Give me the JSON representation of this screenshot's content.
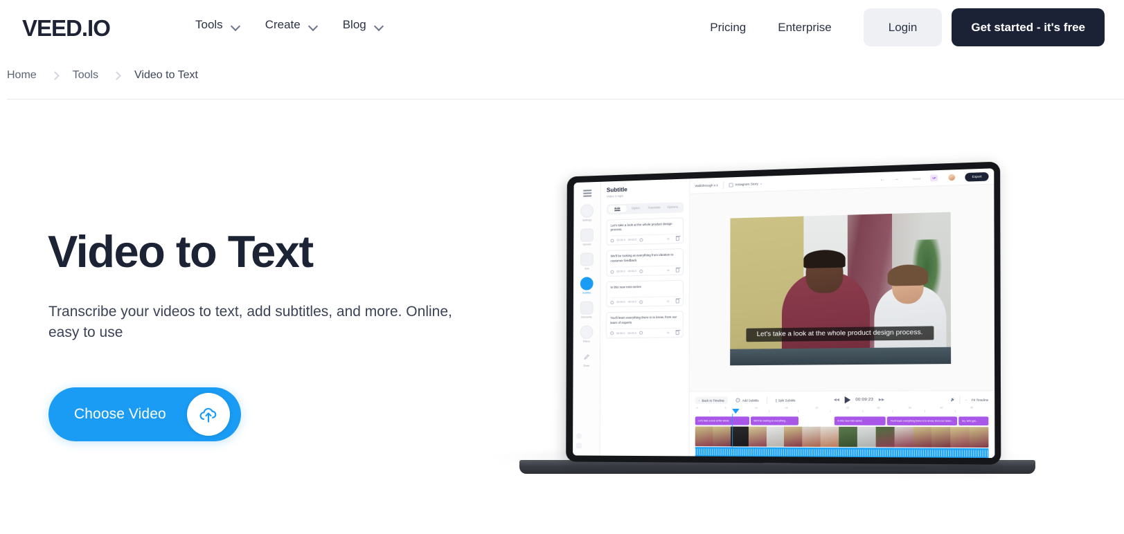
{
  "header": {
    "logo": "VEED.IO",
    "nav": [
      {
        "label": "Tools",
        "has_dropdown": true
      },
      {
        "label": "Create",
        "has_dropdown": true
      },
      {
        "label": "Blog",
        "has_dropdown": true
      }
    ],
    "links": [
      {
        "label": "Pricing"
      },
      {
        "label": "Enterprise"
      }
    ],
    "login_label": "Login",
    "cta_label": "Get started - it's free",
    "cta_bg": "#1b2236",
    "login_bg": "#eef0f3"
  },
  "breadcrumb": {
    "items": [
      {
        "label": "Home"
      },
      {
        "label": "Tools"
      },
      {
        "label": "Video to Text"
      }
    ]
  },
  "hero": {
    "title": "Video to Text",
    "subtitle": "Transcribe your videos to text, add subtitles, and more. Online, easy to use",
    "cta_label": "Choose Video",
    "cta_bg": "#1a9cf5",
    "upload_icon": "cloud-upload-icon"
  },
  "editor": {
    "sidebar": [
      {
        "label": "Settings",
        "icon": "gear-icon",
        "active": false
      },
      {
        "label": "Upload",
        "icon": "upload-icon",
        "active": false
      },
      {
        "label": "Text",
        "icon": "text-icon",
        "active": false
      },
      {
        "label": "Subtitle",
        "icon": "subtitle-icon",
        "active": true
      },
      {
        "label": "Elements",
        "icon": "elements-icon",
        "active": false
      },
      {
        "label": "Filters",
        "icon": "filters-icon",
        "active": false
      },
      {
        "label": "Draw",
        "icon": "pencil-icon",
        "active": false
      }
    ],
    "panel": {
      "title": "Subtitle",
      "filename": "Video 2.mp4",
      "tabs": [
        {
          "label": "Edit",
          "active": true
        },
        {
          "label": "Styles",
          "active": false
        },
        {
          "label": "Translate",
          "active": false
        },
        {
          "label": "Options",
          "active": false
        }
      ],
      "entries": [
        {
          "text": "Let's take a look at the whole product design process.",
          "start": "00:00.0",
          "end": "00:03.0",
          "duration": "3s"
        },
        {
          "text": "We'll be looking at everything from ideation to customer feedback",
          "start": "00:00.0",
          "end": "00:03.0",
          "duration": "3s"
        },
        {
          "text": "In this new mini-series",
          "start": "00:00.0",
          "end": "00:03.0",
          "duration": "3s"
        },
        {
          "text": "You'll learn everything there is to know, from our team of experts",
          "start": "00:00.0",
          "end": "00:03.0",
          "duration": "3s"
        }
      ]
    },
    "topbar": {
      "project": "Walkthrough v.1",
      "format": "Instagram Story",
      "undo_icon": "undo-arrow-icon",
      "redo_icon": "redo-arrow-icon",
      "saved": "Saved",
      "badge": "VP",
      "avatar": "user-avatar",
      "export_label": "Export"
    },
    "preview": {
      "subtitle_overlay": "Let's take a look at the whole product design process."
    },
    "timeline": {
      "back_label": "Back to Timeline",
      "add_label": "Add Subtitle",
      "split_label": "Split Subtitle",
      "current_time": "00:09:23",
      "fit_label": "Fit Timeline",
      "volume_icon": "speaker-icon",
      "zoom_out_icon": "minus-icon",
      "ruler_marks": [
        "5",
        "5",
        "10",
        "15",
        "20",
        "25",
        "30",
        "35",
        "40",
        "45"
      ],
      "clips": [
        {
          "label": "Let's take a look at the whole",
          "width": 20
        },
        {
          "label": "We'll be looking at everything...",
          "width": 17
        },
        {
          "label": "",
          "width": 11,
          "empty": true
        },
        {
          "label": "In this new mini-series",
          "width": 18
        },
        {
          "label": "You'll learn everything there is to know, from our team...",
          "width": 25
        },
        {
          "label": "So, let's get...",
          "width": 9
        }
      ]
    }
  }
}
